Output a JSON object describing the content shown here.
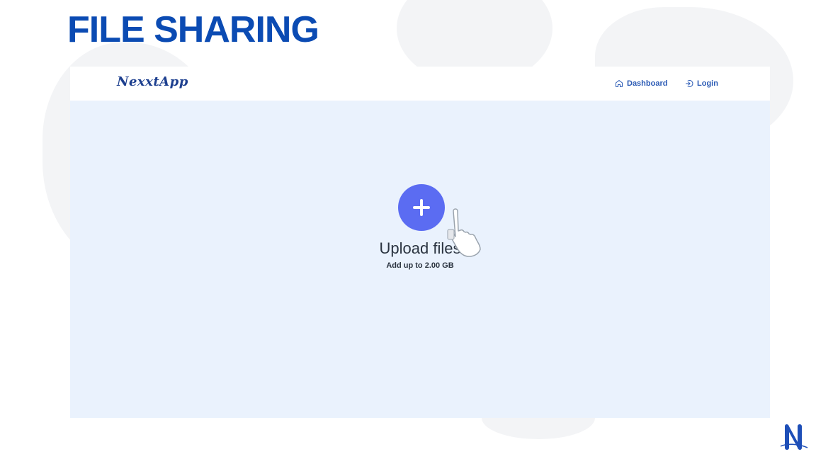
{
  "page_title": "FILE SHARING",
  "app": {
    "logo": "NexxtApp",
    "nav": {
      "dashboard": {
        "label": "Dashboard",
        "icon": "home-icon"
      },
      "login": {
        "label": "Login",
        "icon": "login-icon"
      }
    }
  },
  "upload": {
    "title": "Upload files",
    "subtitle": "Add up to 2.00 GB",
    "button_icon": "plus-icon"
  },
  "colors": {
    "title_blue": "#0b4bb3",
    "accent": "#5b6cf2",
    "upload_bg": "#eaf2fd"
  }
}
